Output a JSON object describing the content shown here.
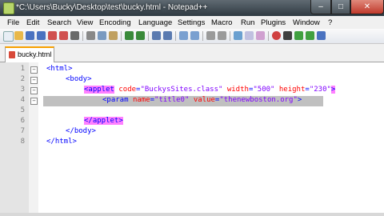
{
  "window": {
    "title": "*C:\\Users\\Bucky\\Desktop\\test\\bucky.html - Notepad++",
    "minimize_label": "–",
    "maximize_label": "□",
    "close_label": "✕"
  },
  "menu": [
    "File",
    "Edit",
    "Search",
    "View",
    "Encoding",
    "Language",
    "Settings",
    "Macro",
    "Run",
    "Plugins",
    "Window",
    "?"
  ],
  "toolbar_icons": [
    "new-file-icon",
    "open-file-icon",
    "save-icon",
    "save-all-icon",
    "close-icon",
    "close-all-icon",
    "print-icon",
    "cut-icon",
    "copy-icon",
    "paste-icon",
    "undo-icon",
    "redo-icon",
    "find-icon",
    "replace-icon",
    "zoom-in-icon",
    "zoom-out-icon",
    "sync-v-icon",
    "sync-h-icon",
    "word-wrap-icon",
    "show-all-icon",
    "indent-guide-icon",
    "record-macro-icon",
    "stop-macro-icon",
    "play-macro-icon",
    "run-macro-icon",
    "save-macro-icon"
  ],
  "tab": {
    "label": "bucky.html"
  },
  "editor": {
    "line_numbers": [
      "1",
      "2",
      "3",
      "4",
      "5",
      "6",
      "7",
      "8"
    ],
    "lines": [
      {
        "indent": "",
        "tag_open": "<html>",
        "attrs": []
      },
      {
        "indent": "    ",
        "tag_open": "<body>",
        "attrs": []
      },
      {
        "indent": "        ",
        "tag_open": "<applet",
        "attrs": [
          {
            "name": "code",
            "value": "\"BuckysSites.class\""
          },
          {
            "name": "width",
            "value": "\"500\""
          },
          {
            "name": "height",
            "value": "\"230\""
          }
        ],
        "tag_close": ">"
      },
      {
        "indent": "            ",
        "tag_open": "<param",
        "attrs": [
          {
            "name": "name",
            "value": "\"title0\""
          },
          {
            "name": "value",
            "value": "\"thenewboston.org\""
          }
        ],
        "tag_close": ">"
      },
      {
        "indent": "",
        "tag_open": "",
        "attrs": []
      },
      {
        "indent": "        ",
        "tag_open": "</applet>",
        "attrs": []
      },
      {
        "indent": "    ",
        "tag_open": "</body>",
        "attrs": []
      },
      {
        "indent": "",
        "tag_open": "</html>",
        "attrs": []
      }
    ]
  },
  "colors": {
    "tag": "#0000ff",
    "attribute": "#ff0000",
    "value": "#8000ff",
    "tag_match_highlight": "#ff80ff",
    "tab_accent": "#f7a000"
  }
}
